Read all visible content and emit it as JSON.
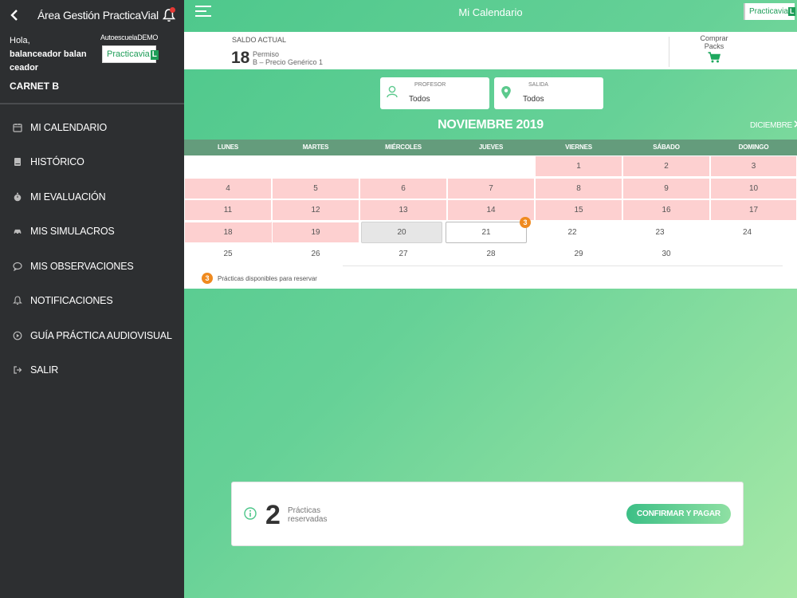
{
  "sidebar": {
    "app_title": "Área Gestión PracticaVial",
    "greeting": "Hola,",
    "user_name": "balanceador balan ceador",
    "school": "AutoescuelaDEMO",
    "logo_text": "Practicavia",
    "logo_box": "L",
    "carnet": "CARNET B",
    "nav": [
      {
        "label": "MI CALENDARIO",
        "icon": "calendar-icon"
      },
      {
        "label": "HISTÓRICO",
        "icon": "book-icon"
      },
      {
        "label": "MI EVALUACIÓN",
        "icon": "stopwatch-icon"
      },
      {
        "label": "MIS SIMULACROS",
        "icon": "car-icon"
      },
      {
        "label": "MIS OBSERVACIONES",
        "icon": "chat-icon"
      },
      {
        "label": "NOTIFICACIONES",
        "icon": "bell-icon"
      },
      {
        "label": "GUÍA PRÁCTICA AUDIOVISUAL",
        "icon": "play-icon"
      },
      {
        "label": "SALIR",
        "icon": "logout-icon"
      }
    ]
  },
  "header": {
    "title": "Mi Calendario",
    "logo_text": "Practicavia",
    "logo_box": "L"
  },
  "balance": {
    "label": "SALDO ACTUAL",
    "value": "18",
    "permit": "Permiso",
    "price": "B – Precio Genérico 1",
    "buy_line1": "Comprar",
    "buy_line2": "Packs"
  },
  "filters": {
    "teacher": {
      "label": "PROFESOR",
      "value": "Todos"
    },
    "departure": {
      "label": "SALIDA",
      "value": "Todos"
    }
  },
  "calendar": {
    "month": "NOVIEMBRE 2019",
    "next_month": "DICIEMBRE",
    "weekdays": [
      "LUNES",
      "MARTES",
      "MIÉRCOLES",
      "JUEVES",
      "VIERNES",
      "SÁBADO",
      "DOMINGO"
    ],
    "badge_day": "21",
    "badge_count": "3",
    "legend_count": "3",
    "legend_text": "Prácticas disponibles para reservar"
  },
  "summary": {
    "count": "2",
    "line1": "Prácticas",
    "line2": "reservadas",
    "confirm_label": "CONFIRMAR Y PAGAR"
  },
  "colors": {
    "sidebar_bg": "#2d2f31",
    "accent_green": "#1e9d58",
    "available_day": "#fdd0d0",
    "badge_orange": "#ef8a1f"
  }
}
